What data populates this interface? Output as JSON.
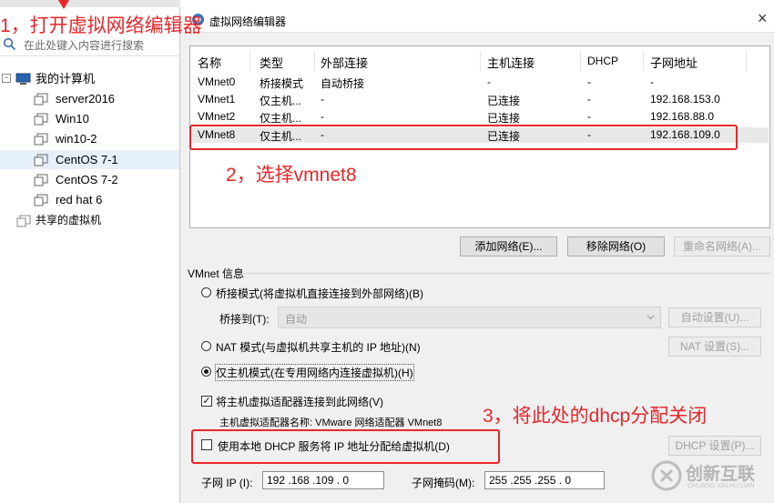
{
  "sidebar": {
    "search_placeholder": "在此处键入内容进行搜索",
    "tree": [
      {
        "label": "我的计算机"
      },
      {
        "label": "server2016"
      },
      {
        "label": "Win10"
      },
      {
        "label": "win10-2"
      },
      {
        "label": "CentOS 7-1"
      },
      {
        "label": "CentOS 7-2"
      },
      {
        "label": "red hat 6"
      },
      {
        "label": "共享的虚拟机"
      }
    ]
  },
  "dialog": {
    "title": "虚拟网络编辑器",
    "close_glyph": "×",
    "columns": [
      "名称",
      "类型",
      "外部连接",
      "主机连接",
      "DHCP",
      "子网地址"
    ],
    "rows": [
      [
        "VMnet0",
        "桥接模式",
        "自动桥接",
        "-",
        "-",
        "-"
      ],
      [
        "VMnet1",
        "仅主机...",
        "-",
        "已连接",
        "-",
        "192.168.153.0"
      ],
      [
        "VMnet2",
        "仅主机...",
        "-",
        "已连接",
        "-",
        "192.168.88.0"
      ],
      [
        "VMnet8",
        "仅主机...",
        "-",
        "已连接",
        "-",
        "192.168.109.0"
      ]
    ],
    "buttons": {
      "add": "添加网络(E)...",
      "remove": "移除网络(O)",
      "rename": "重命名网络(A)...",
      "auto": "自动设置(U)...",
      "nat": "NAT 设置(S)...",
      "dhcp": "DHCP 设置(P)..."
    },
    "info_title": "VMnet 信息",
    "bridge_radio": "桥接模式(将虚拟机直接连接到外部网络)(B)",
    "bridge_to_label": "桥接到(T):",
    "bridge_to_value": "自动",
    "nat_radio": "NAT 模式(与虚拟机共享主机的 IP 地址)(N)",
    "hostonly_radio": "仅主机模式(在专用网络内连接虚拟机)(H)",
    "connect_check": "将主机虚拟适配器连接到此网络(V)",
    "adapter_name": "主机虚拟适配器名称: VMware 网络适配器 VMnet8",
    "dhcp_check": "使用本地 DHCP 服务将 IP 地址分配给虚拟机(D)",
    "subnet_ip_label": "子网 IP (I):",
    "subnet_ip_value": "192 .168 .109 . 0",
    "mask_label": "子网掩码(M):",
    "mask_value": "255 .255 .255 . 0"
  },
  "annotations": {
    "step1": "1，打开虚拟网络编辑器",
    "step2": "2，选择vmnet8",
    "step3": "3，将此处的dhcp分配关闭"
  },
  "watermark": {
    "name": "创新互联",
    "sub": "CHUANG XIN HU LIAN"
  },
  "colors": {
    "annotation": "#e8262a",
    "watermark": "#b5b5b5"
  }
}
